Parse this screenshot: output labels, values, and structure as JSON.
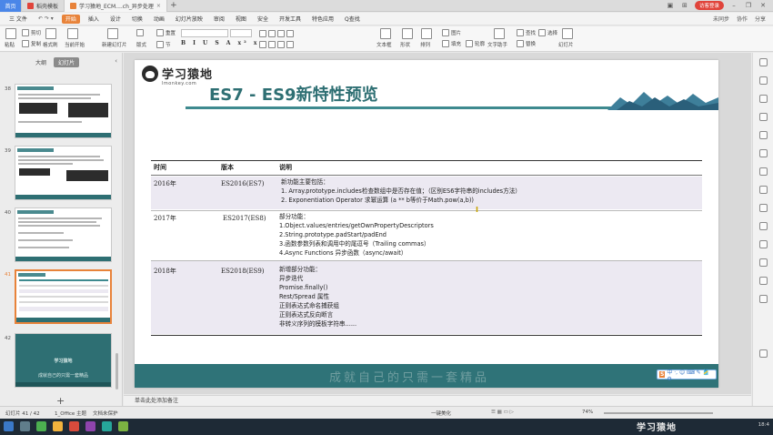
{
  "titlebar": {
    "home_tab": "首页",
    "tabs": [
      {
        "label": "稻壳模板",
        "color": "#e0443b"
      },
      {
        "label": "学习猿地_ECM....ch_异步处理",
        "color": "#e8833a"
      }
    ],
    "login_label": "访客登录"
  },
  "menubar": {
    "file": "三 文件",
    "items": [
      "开始",
      "插入",
      "设计",
      "切换",
      "动画",
      "幻灯片放映",
      "审阅",
      "视图",
      "安全",
      "开发工具",
      "特色应用"
    ],
    "search": "Q查找",
    "right": [
      "未同步",
      "协作",
      "分享"
    ]
  },
  "ribbon": {
    "paste": "粘贴",
    "cut": "剪切",
    "copy": "复制",
    "format_painter": "格式刷",
    "from_current": "当前开始",
    "new_slide": "新建幻灯片",
    "layout": "版式",
    "section": "节",
    "reset": "重置",
    "format_row": "B I U S A x² x₂",
    "picture": "图片",
    "fill": "填充",
    "text_box": "文本框",
    "shape": "形状",
    "arrange": "排列",
    "outline": "轮廓",
    "text_assistant": "文字助手",
    "find": "查找",
    "replace": "替换",
    "select": "选择",
    "slideshow": "幻灯片",
    "font_name": "",
    "font_size": ""
  },
  "left_panel": {
    "tab_outline": "大纲",
    "tab_slides": "幻灯片",
    "thumbs": [
      {
        "num": "38"
      },
      {
        "num": "39"
      },
      {
        "num": "40"
      },
      {
        "num": "41"
      },
      {
        "num": "42",
        "text": "学习猿地",
        "sub": "成就自己的只需一套精品"
      }
    ]
  },
  "slide": {
    "logo_text": "学习猿地",
    "logo_url": "lmonkey.com",
    "title": "ES7 - ES9新特性预览",
    "table": {
      "headers": [
        "时间",
        "版本",
        "说明"
      ],
      "rows": [
        {
          "time": "2016年",
          "version": "ES2016(ES7)",
          "lines": [
            "新功能主要包括：",
            "1. Array.prototype.includes检查数组中是否存在值；（区别ES6字符串的includes方法）",
            "2. Exponentiation Operator 求幂运算 (a ** b等价于Math.pow(a,b))"
          ]
        },
        {
          "time": "2017年",
          "version": "ES2017(ES8)",
          "lines": [
            "部分功能：",
            "1.Object.values/entries/getOwnPropertyDescriptors",
            "2.String.prototype.padStart/padEnd",
            "3.函数参数列表和调用中的尾逗号（Trailing commas）",
            "4.Async Functions 异步函数（async/await）"
          ]
        },
        {
          "time": "2018年",
          "version": "ES2018(ES9)",
          "lines": [
            "新增部分功能：",
            "异步迭代",
            "Promise.finally()",
            "Rest/Spread 属性",
            "正则表达式命名捕获组",
            "正则表达式反向断言",
            "非转义序列的模板字符串......"
          ]
        }
      ]
    },
    "footer_slogan": "成就自己的只需一套精品",
    "ime": "中 ·, ☺ ⌨ ✎ 🎽 ⚙"
  },
  "notes": {
    "placeholder": "单击此处添加备注"
  },
  "statusbar": {
    "slide_count": "幻灯片 41 / 42",
    "theme": "1_Office 主题",
    "backup": "文档未保护",
    "beautify": "一键美化",
    "zoom": "74%"
  },
  "taskbar": {
    "watermark": "学习猿地",
    "time": "18:4"
  }
}
